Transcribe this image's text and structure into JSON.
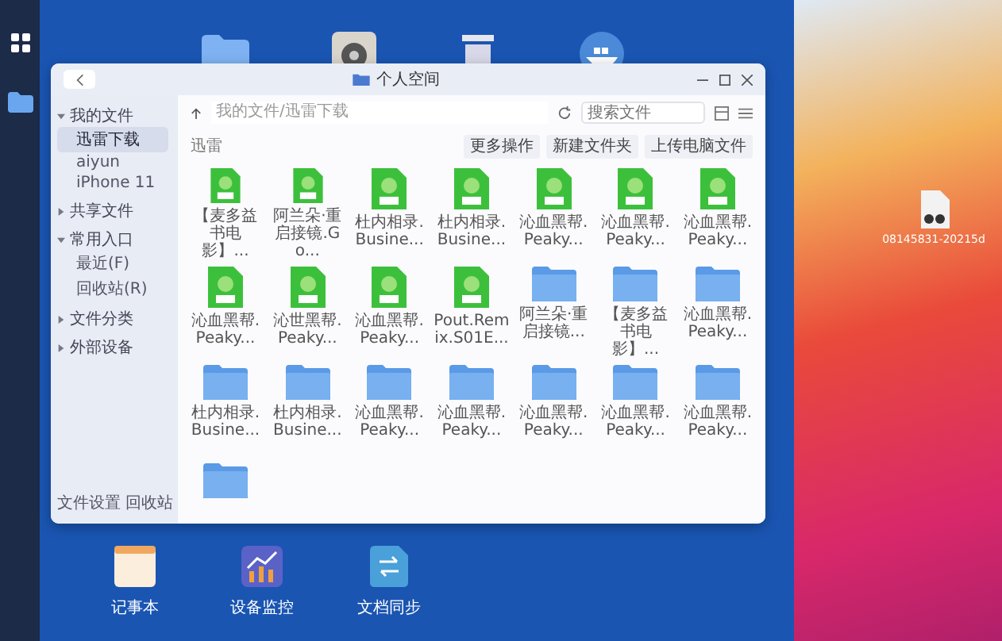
{
  "window": {
    "title": "个人空间"
  },
  "sidebar": {
    "sections": [
      {
        "label": "我的文件",
        "expanded": true,
        "children": [
          {
            "label": "迅雷下载",
            "selected": true
          },
          {
            "label": "aiyun",
            "selected": false
          },
          {
            "label": "iPhone 11",
            "selected": false
          }
        ]
      },
      {
        "label": "共享文件",
        "expanded": false
      },
      {
        "label": "常用入口",
        "expanded": true,
        "children": [
          {
            "label": "最近(F)",
            "selected": false
          },
          {
            "label": "回收站(R)",
            "selected": false
          }
        ]
      },
      {
        "label": "文件分类",
        "expanded": false
      },
      {
        "label": "外部设备",
        "expanded": false
      }
    ],
    "footer": [
      "文件设置",
      "回收站"
    ]
  },
  "toolbar": {
    "path": "我的文件/迅雷下载",
    "search": {
      "placeholder": "搜索文件"
    }
  },
  "actions": {
    "folder_label": "迅雷",
    "buttons": [
      "更多操作",
      "新建文件夹",
      "上传电脑文件"
    ]
  },
  "files": [
    {
      "kind": "apk",
      "name": "【麦多益书电影】..."
    },
    {
      "kind": "apk",
      "name": "阿兰朵·重启接镜.Go..."
    },
    {
      "kind": "apk",
      "name": "杜内相录.Busine..."
    },
    {
      "kind": "apk",
      "name": "杜内相录.Busine..."
    },
    {
      "kind": "apk",
      "name": "沁血黑帮.Peaky..."
    },
    {
      "kind": "apk",
      "name": "沁血黑帮.Peaky..."
    },
    {
      "kind": "apk",
      "name": "沁血黑帮.Peaky..."
    },
    {
      "kind": "apk",
      "name": "沁血黑帮.Peaky..."
    },
    {
      "kind": "apk",
      "name": "沁世黑帮.Peaky..."
    },
    {
      "kind": "apk",
      "name": "沁血黑帮.Peaky..."
    },
    {
      "kind": "apk",
      "name": "Pout.Remix.S01E..."
    },
    {
      "kind": "folder",
      "name": "阿兰朵·重启接镜..."
    },
    {
      "kind": "folder",
      "name": "【麦多益书电影】..."
    },
    {
      "kind": "folder",
      "name": "沁血黑帮.Peaky..."
    },
    {
      "kind": "folder",
      "name": "杜内相录.Busine..."
    },
    {
      "kind": "folder",
      "name": "杜内相录.Busine..."
    },
    {
      "kind": "folder",
      "name": "沁血黑帮.Peaky..."
    },
    {
      "kind": "folder",
      "name": "沁血黑帮.Peaky..."
    },
    {
      "kind": "folder",
      "name": "沁血黑帮.Peaky..."
    },
    {
      "kind": "folder",
      "name": "沁血黑帮.Peaky..."
    },
    {
      "kind": "folder",
      "name": "沁血黑帮.Peaky..."
    },
    {
      "kind": "folder"
    }
  ],
  "desktop_apps": [
    {
      "kind": "notes",
      "label": "记事本"
    },
    {
      "kind": "monitor",
      "label": "设备监控"
    },
    {
      "kind": "sync",
      "label": "文档同步"
    }
  ],
  "desktop_file": {
    "name": "08145831-20215d"
  }
}
